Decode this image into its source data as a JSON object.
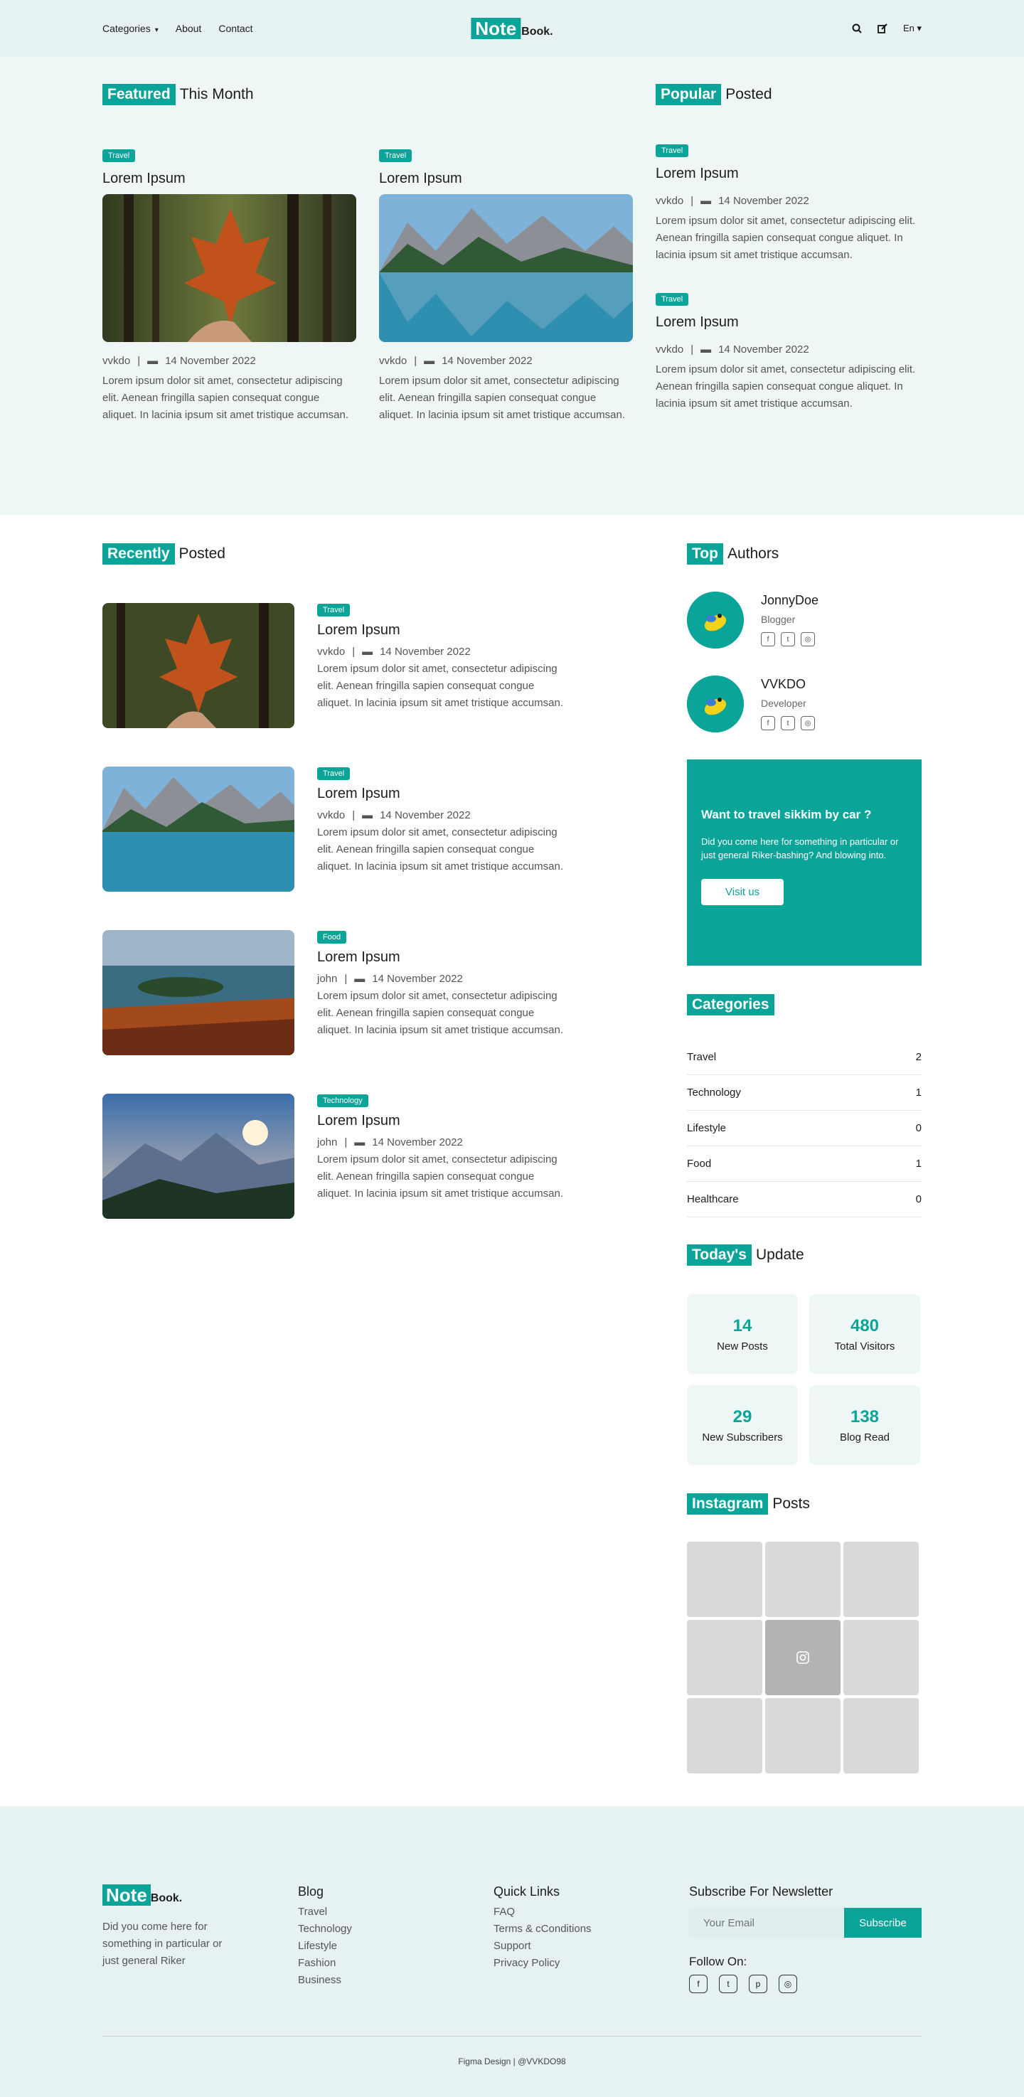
{
  "header": {
    "nav": [
      "Categories",
      "About",
      "Contact"
    ],
    "logo_hl": "Note",
    "logo_rest": "Book.",
    "lang": "En"
  },
  "featured": {
    "title_hl": "Featured",
    "title_rest": "This Month",
    "posts": [
      {
        "tag": "Travel",
        "title": "Lorem Ipsum",
        "author": "vvkdo",
        "date": "14 November 2022",
        "excerpt": "Lorem ipsum dolor sit amet, consectetur adipiscing elit. Aenean fringilla sapien consequat congue aliquet. In lacinia ipsum sit amet tristique accumsan."
      },
      {
        "tag": "Travel",
        "title": "Lorem Ipsum",
        "author": "vvkdo",
        "date": "14 November 2022",
        "excerpt": "Lorem ipsum dolor sit amet, consectetur adipiscing elit. Aenean fringilla sapien consequat congue aliquet. In lacinia ipsum sit amet tristique accumsan."
      }
    ]
  },
  "popular": {
    "title_hl": "Popular",
    "title_rest": "Posted",
    "posts": [
      {
        "tag": "Travel",
        "title": "Lorem Ipsum",
        "author": "vvkdo",
        "date": "14 November 2022",
        "excerpt": "Lorem ipsum dolor sit amet, consectetur adipiscing elit. Aenean fringilla sapien consequat congue aliquet. In lacinia ipsum sit amet tristique accumsan."
      },
      {
        "tag": "Travel",
        "title": "Lorem Ipsum",
        "author": "vvkdo",
        "date": "14 November 2022",
        "excerpt": "Lorem ipsum dolor sit amet, consectetur adipiscing elit. Aenean fringilla sapien consequat congue aliquet. In lacinia ipsum sit amet tristique accumsan."
      }
    ]
  },
  "recent": {
    "title_hl": "Recently",
    "title_rest": "Posted",
    "posts": [
      {
        "tag": "Travel",
        "title": "Lorem Ipsum",
        "author": "vvkdo",
        "date": "14 November 2022",
        "excerpt": "Lorem ipsum dolor sit amet, consectetur adipiscing elit. Aenean fringilla sapien consequat congue aliquet. In lacinia ipsum sit amet tristique accumsan."
      },
      {
        "tag": "Travel",
        "title": "Lorem Ipsum",
        "author": "vvkdo",
        "date": "14 November 2022",
        "excerpt": "Lorem ipsum dolor sit amet, consectetur adipiscing elit. Aenean fringilla sapien consequat congue aliquet. In lacinia ipsum sit amet tristique accumsan."
      },
      {
        "tag": "Food",
        "title": "Lorem Ipsum",
        "author": "john",
        "date": "14 November 2022",
        "excerpt": "Lorem ipsum dolor sit amet, consectetur adipiscing elit. Aenean fringilla sapien consequat congue aliquet. In lacinia ipsum sit amet tristique accumsan."
      },
      {
        "tag": "Technology",
        "title": "Lorem Ipsum",
        "author": "john",
        "date": "14 November 2022",
        "excerpt": "Lorem ipsum dolor sit amet, consectetur adipiscing elit. Aenean fringilla sapien consequat congue aliquet. In lacinia ipsum sit amet tristique accumsan."
      }
    ]
  },
  "authors": {
    "title_hl": "Top",
    "title_rest": "Authors",
    "list": [
      {
        "name": "JonnyDoe",
        "role": "Blogger"
      },
      {
        "name": "VVKDO",
        "role": "Developer"
      }
    ]
  },
  "promo": {
    "title": "Want to travel sikkim by car ?",
    "text": "Did you come here for something in particular or just general Riker-bashing? And blowing into.",
    "button": "Visit us"
  },
  "categories": {
    "title": "Categories",
    "items": [
      {
        "name": "Travel",
        "count": "2"
      },
      {
        "name": "Technology",
        "count": "1"
      },
      {
        "name": "Lifestyle",
        "count": "0"
      },
      {
        "name": "Food",
        "count": "1"
      },
      {
        "name": "Healthcare",
        "count": "0"
      }
    ]
  },
  "today": {
    "title_hl": "Today's",
    "title_rest": "Update",
    "stats": [
      {
        "num": "14",
        "label": "New Posts"
      },
      {
        "num": "480",
        "label": "Total Visitors"
      },
      {
        "num": "29",
        "label": "New Subscribers"
      },
      {
        "num": "138",
        "label": "Blog Read"
      }
    ]
  },
  "instagram": {
    "title_hl": "Instagram",
    "title_rest": "Posts"
  },
  "footer": {
    "about": "Did you come here for something in particular or just general Riker",
    "blog_title": "Blog",
    "blog_links": [
      "Travel",
      "Technology",
      "Lifestyle",
      "Fashion",
      "Business"
    ],
    "quick_title": "Quick Links",
    "quick_links": [
      "FAQ",
      "Terms & cConditions",
      "Support",
      "Privacy Policy"
    ],
    "news_title": "Subscribe For Newsletter",
    "email_placeholder": "Your Email",
    "subscribe": "Subscribe",
    "follow": "Follow On:",
    "copyright": "Figma Design | @VVKDO98"
  },
  "colors": {
    "accent": "#0aa598",
    "header_bg": "#e6f1f1",
    "featured_bg": "#eef6f6"
  }
}
